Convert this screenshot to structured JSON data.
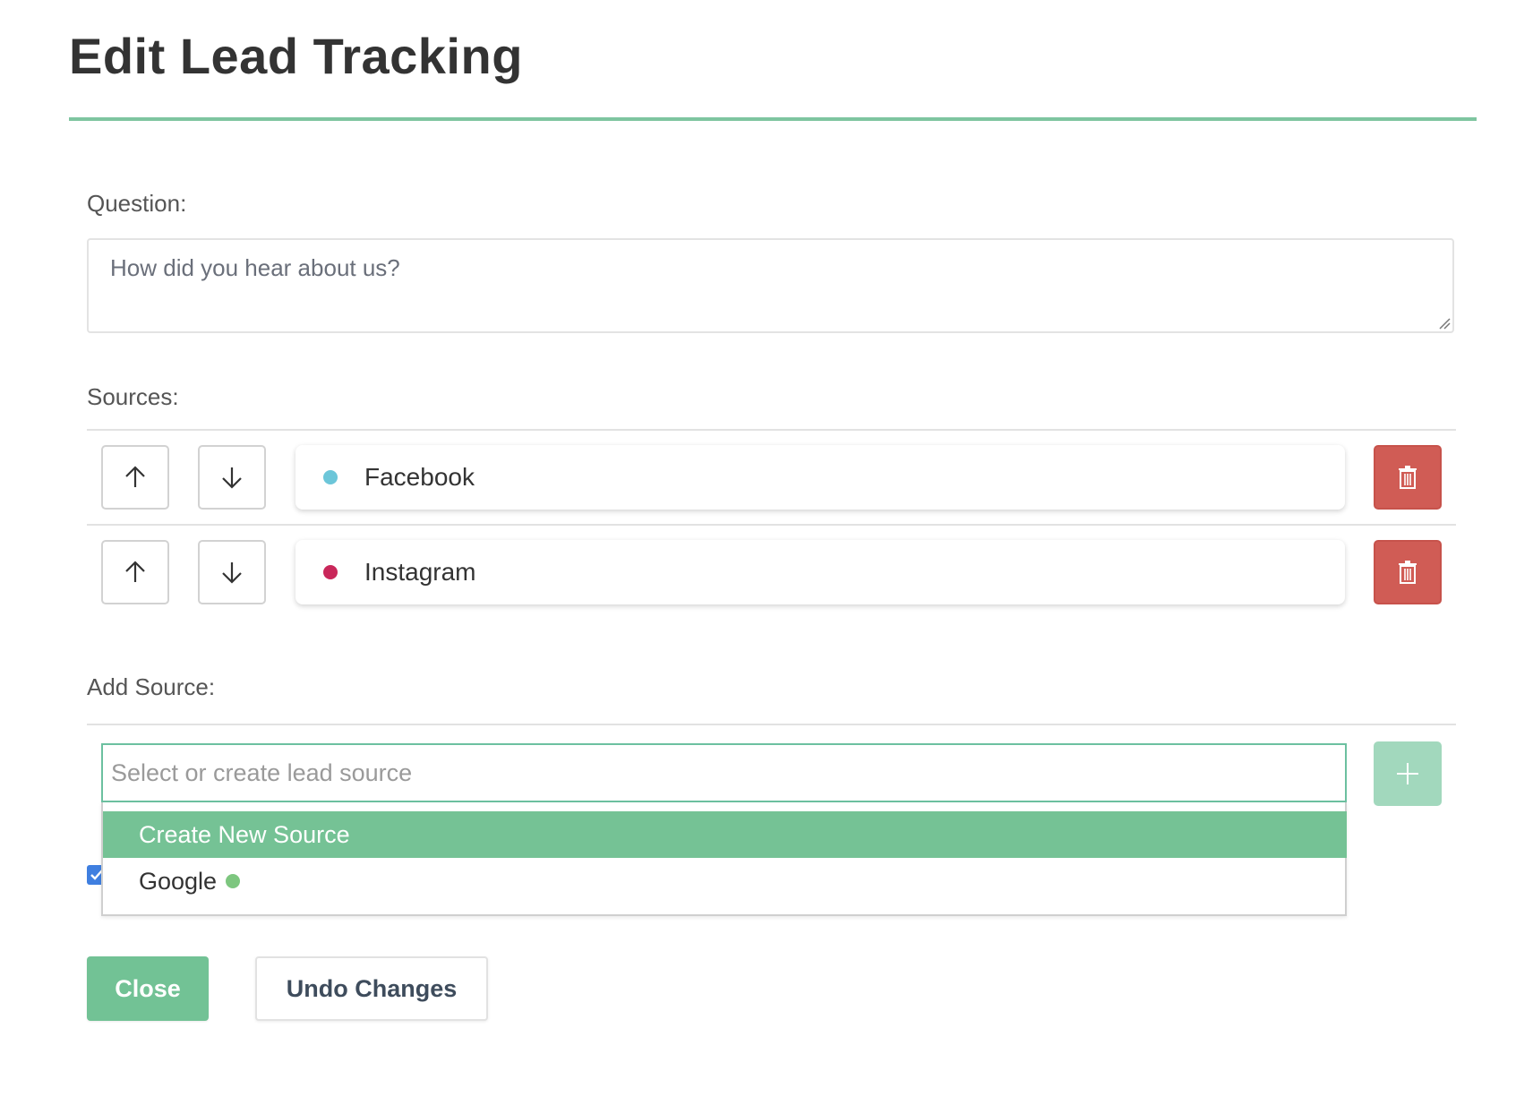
{
  "title": "Edit Lead Tracking",
  "question": {
    "label": "Question:",
    "value": "How did you hear about us?"
  },
  "sources": {
    "label": "Sources:",
    "items": [
      {
        "name": "Facebook",
        "color": "#6cc6d9"
      },
      {
        "name": "Instagram",
        "color": "#c9275a"
      }
    ]
  },
  "add_source": {
    "label": "Add Source:",
    "placeholder": "Select or create lead source",
    "dropdown": [
      {
        "label": "Create New Source",
        "highlighted": true
      },
      {
        "label": "Google",
        "color": "#7dc67f"
      }
    ]
  },
  "actions": {
    "close_label": "Close",
    "undo_label": "Undo Changes"
  },
  "colors": {
    "accent": "#72c295",
    "danger": "#d05c55",
    "checkbox": "#3f7fe0"
  },
  "icons": {
    "up": "arrow-up-icon",
    "down": "arrow-down-icon",
    "delete": "trash-icon",
    "add": "plus-icon"
  }
}
